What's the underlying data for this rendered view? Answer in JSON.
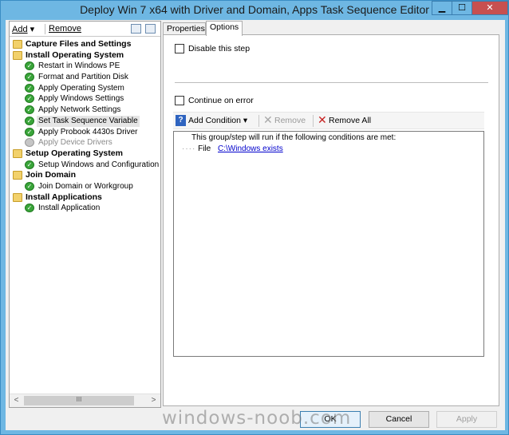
{
  "window": {
    "title": "Deploy Win 7 x64 with Driver and Domain, Apps Task Sequence Editor",
    "minimize": "▁",
    "maximize": "☐",
    "close": "✕"
  },
  "toolbar": {
    "add_label": "Add",
    "add_arrow": "▾",
    "remove_label": "Remove"
  },
  "tree": [
    {
      "type": "group",
      "label": "Capture Files and Settings",
      "icon": "folder-icon"
    },
    {
      "type": "group",
      "label": "Install Operating System",
      "icon": "folder-icon"
    },
    {
      "type": "step",
      "label": "Restart in Windows PE",
      "icon": "check-icon"
    },
    {
      "type": "step",
      "label": "Format and Partition Disk",
      "icon": "check-icon"
    },
    {
      "type": "step",
      "label": "Apply Operating System",
      "icon": "check-icon"
    },
    {
      "type": "step",
      "label": "Apply Windows Settings",
      "icon": "check-icon"
    },
    {
      "type": "step",
      "label": "Apply Network Settings",
      "icon": "check-icon"
    },
    {
      "type": "step",
      "label": "Set Task Sequence Variable",
      "icon": "check-icon",
      "selected": true
    },
    {
      "type": "step",
      "label": "Apply Probook 4430s Driver",
      "icon": "check-icon"
    },
    {
      "type": "step",
      "label": "Apply Device Drivers",
      "icon": "disabled-step-icon",
      "disabled": true
    },
    {
      "type": "group",
      "label": "Setup Operating System",
      "icon": "folder-icon"
    },
    {
      "type": "step",
      "label": "Setup Windows and Configuration",
      "icon": "check-icon"
    },
    {
      "type": "group",
      "label": "Join Domain",
      "icon": "folder-icon"
    },
    {
      "type": "step",
      "label": "Join Domain or Workgroup",
      "icon": "check-icon"
    },
    {
      "type": "group",
      "label": "Install Applications",
      "icon": "folder-icon"
    },
    {
      "type": "step",
      "label": "Install Application",
      "icon": "check-icon"
    }
  ],
  "scrollbar": {
    "left": "<",
    "right": ">",
    "grip": "III"
  },
  "tabs": {
    "properties": "Properties",
    "options": "Options"
  },
  "options": {
    "disable_step": "Disable this step",
    "continue_on_error": "Continue on error",
    "disable_step_checked": false,
    "continue_on_error_checked": false
  },
  "conditions_toolbar": {
    "add_condition": "Add Condition",
    "add_condition_arrow": "▾",
    "remove": "Remove",
    "remove_all": "Remove All"
  },
  "conditions": {
    "header": "This group/step will run if the following conditions are met:",
    "items": [
      {
        "prefix": "File",
        "link": "C:\\Windows exists"
      }
    ]
  },
  "buttons": {
    "ok": "OK",
    "cancel": "Cancel",
    "apply": "Apply"
  },
  "watermark": "windows-noob.com"
}
